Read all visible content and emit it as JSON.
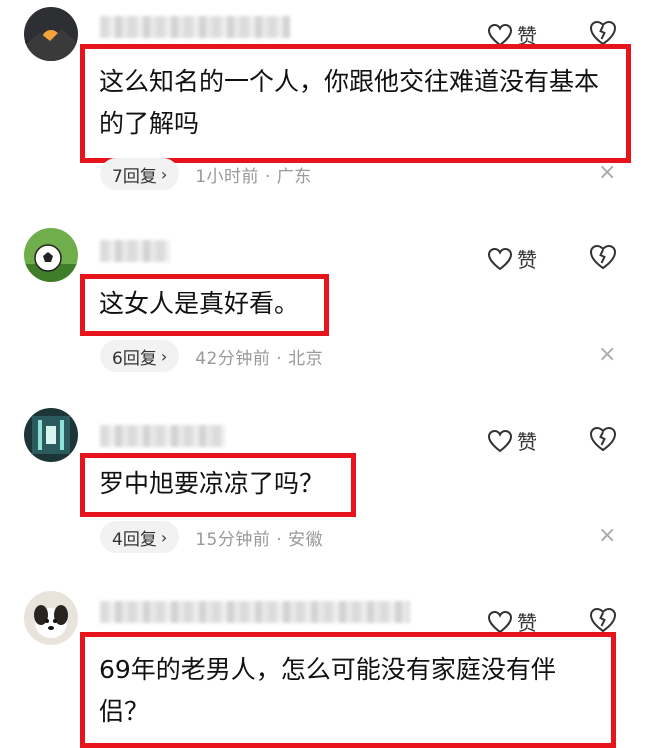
{
  "comments": [
    {
      "like_label": "赞",
      "text": "这么知名的一个人，你跟他交往难道没有基本的了解吗",
      "reply_count": "7回复",
      "time": "1小时前",
      "location": "广东"
    },
    {
      "like_label": "赞",
      "text": "这女人是真好看。",
      "reply_count": "6回复",
      "time": "42分钟前",
      "location": "北京"
    },
    {
      "like_label": "赞",
      "text": "罗中旭要凉凉了吗？",
      "reply_count": "4回复",
      "time": "15分钟前",
      "location": "安徽"
    },
    {
      "like_label": "赞",
      "text": "69年的老男人，怎么可能没有家庭没有伴侣？"
    }
  ],
  "meta_separator": " · ",
  "chevron": "›",
  "close_glyph": "×",
  "colors": {
    "highlight_border": "#e8141b",
    "meta_text": "#999999",
    "pill_bg": "#f2f2f2"
  }
}
